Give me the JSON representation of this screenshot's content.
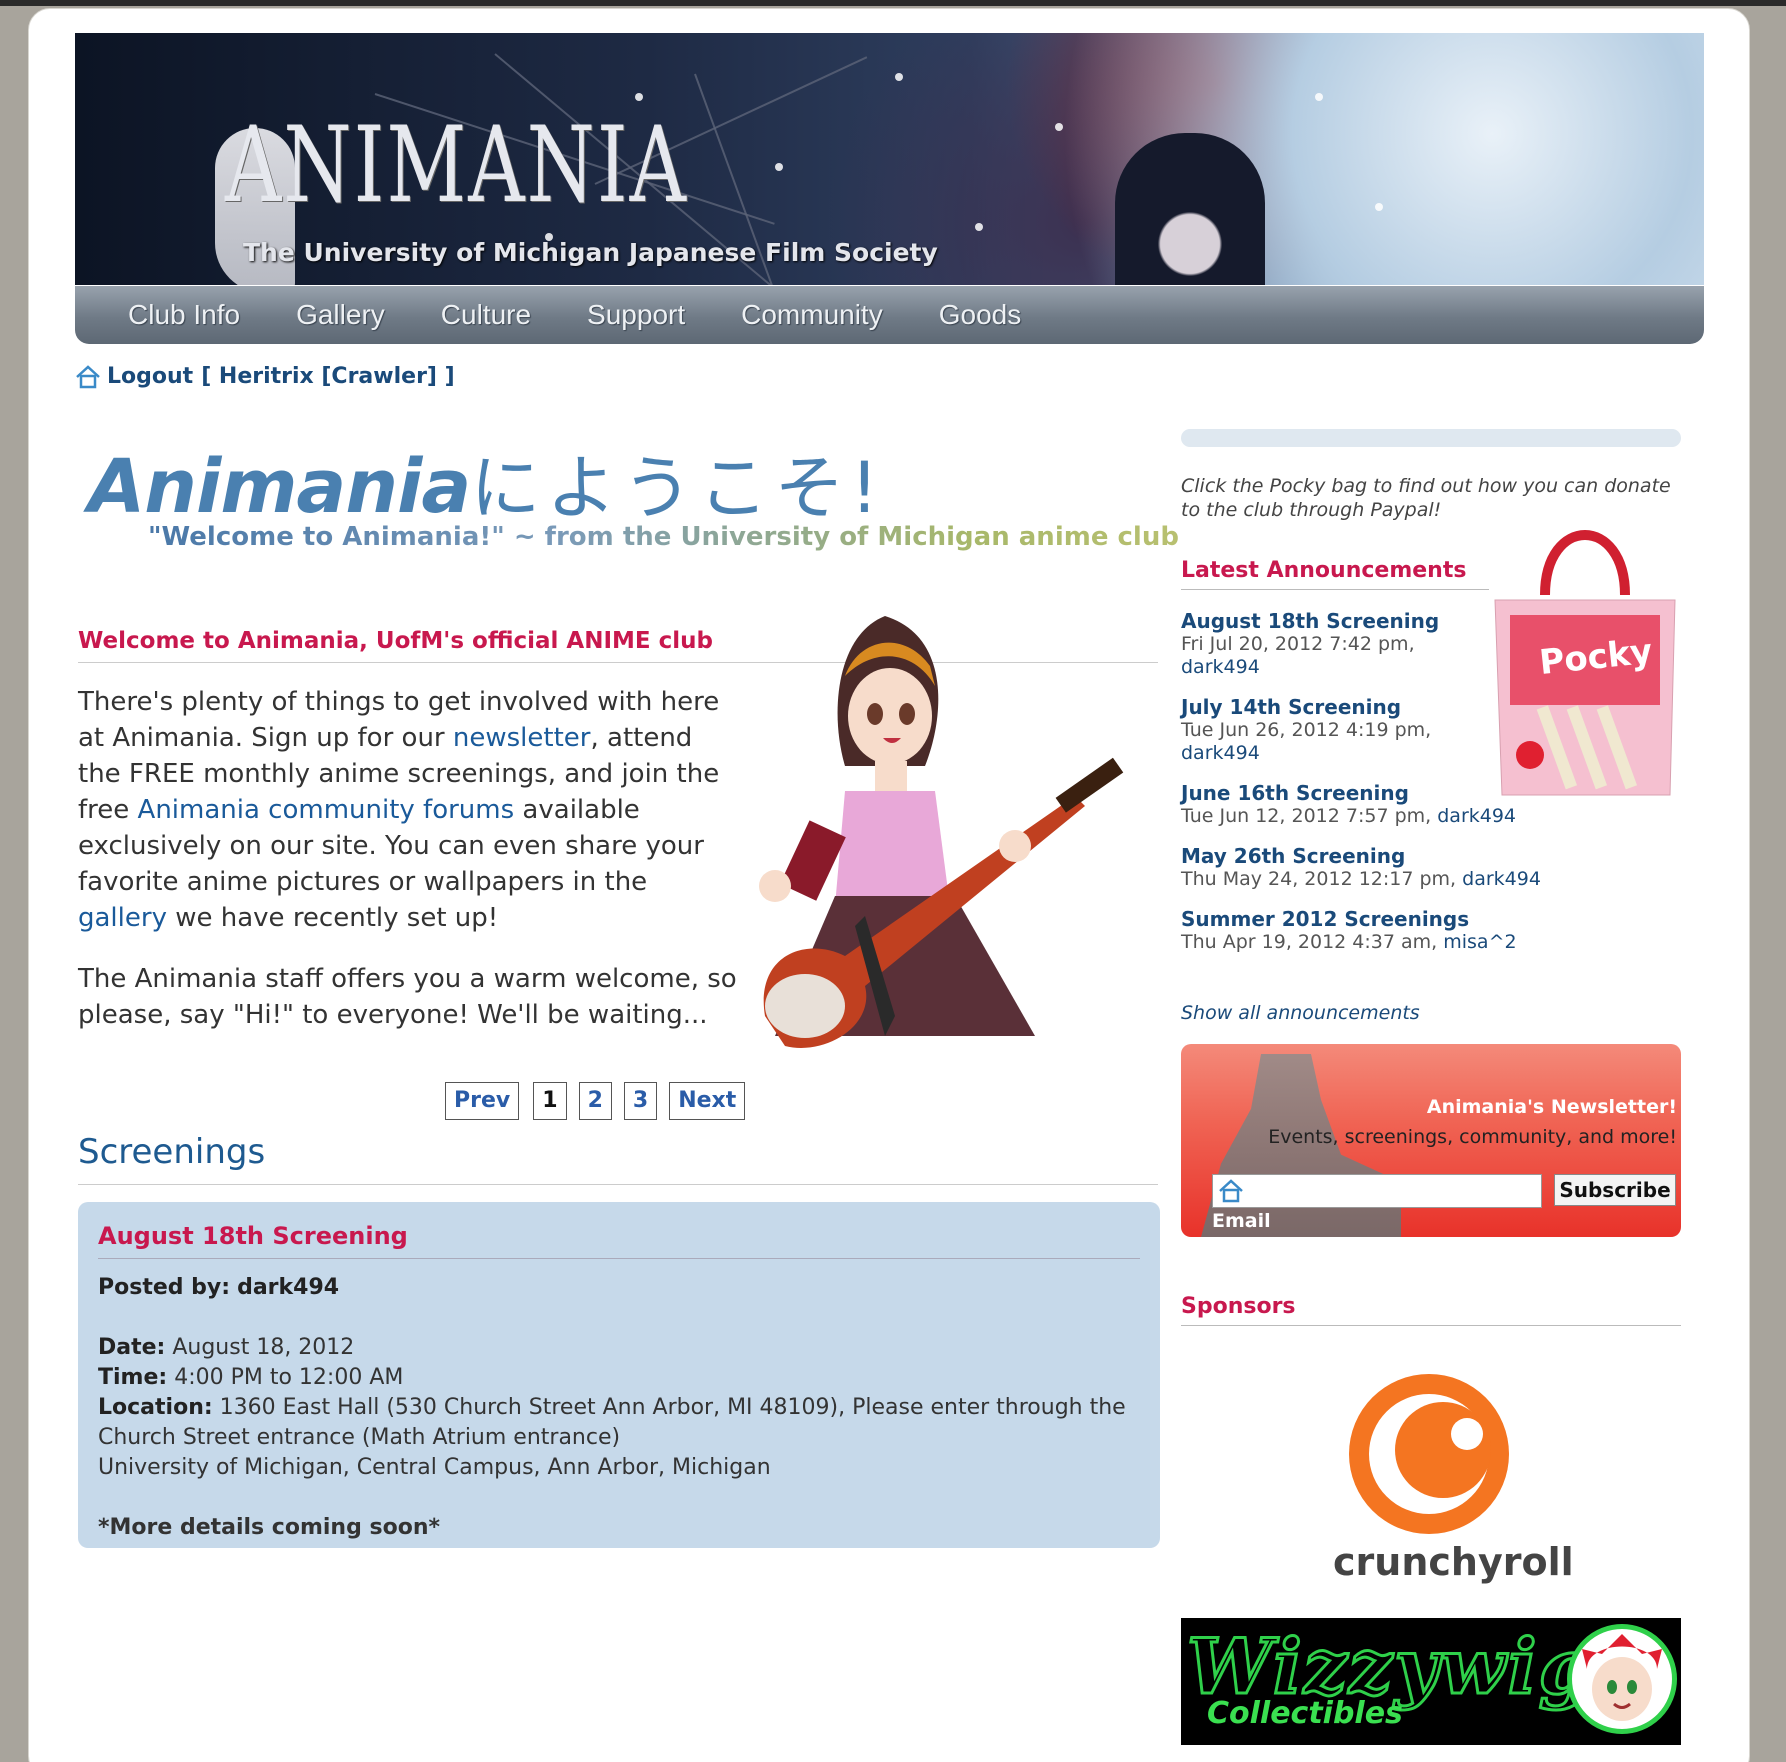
{
  "banner": {
    "logo_text": "ANIMANIA",
    "subtitle": "The University of Michigan Japanese Film Society"
  },
  "nav": {
    "items": [
      "Club Info",
      "Gallery",
      "Culture",
      "Support",
      "Community",
      "Goods"
    ]
  },
  "login": {
    "logout_label": "Logout",
    "user_text": "[ Heritrix [Crawler] ]"
  },
  "welcome": {
    "title_latin": "Animania",
    "title_jp": "にようこそ!",
    "subtitle": "\"Welcome to Animania!\" ~ from the University of Michigan anime club"
  },
  "intro": {
    "heading": "Welcome to Animania, UofM's official ANIME club",
    "p1_a": "There's plenty of things to get involved with here at Animania. Sign up for our ",
    "p1_link1": "newsletter",
    "p1_b": ", attend the FREE monthly anime screenings, and join the free ",
    "p1_link2": "Animania community forums",
    "p1_c": " available exclusively on our site. You can even share your favorite anime pictures or wallpapers in the ",
    "p1_link3": "gallery",
    "p1_d": " we have recently set up!",
    "p2": "The Animania staff offers you a warm welcome, so please, say \"Hi!\" to everyone! We'll be waiting..."
  },
  "pager": {
    "prev": "Prev",
    "pages": [
      "1",
      "2",
      "3"
    ],
    "current": "1",
    "next": "Next"
  },
  "screenings": {
    "heading": "Screenings",
    "post": {
      "title": "August 18th Screening",
      "posted_by_label": "Posted by:",
      "posted_by": "dark494",
      "date_label": "Date:",
      "date": "August 18, 2012",
      "time_label": "Time:",
      "time": "4:00 PM to 12:00 AM",
      "location_label": "Location:",
      "location": "1360 East Hall (530 Church Street Ann Arbor, MI 48109), Please enter through the Church Street entrance (Math Atrium entrance)",
      "location2": "University of Michigan, Central Campus, Ann Arbor, Michigan",
      "note": "*More details coming soon*"
    }
  },
  "sidebar": {
    "donate_note": "Click the Pocky bag to find out how you can donate to the club through Paypal!",
    "announcements_heading": "Latest Announcements",
    "announcements": [
      {
        "title": "August 18th Screening",
        "meta": "Fri Jul 20, 2012 7:42 pm,",
        "user": "dark494"
      },
      {
        "title": "July 14th Screening",
        "meta": "Tue Jun 26, 2012 4:19 pm,",
        "user": "dark494"
      },
      {
        "title": "June 16th Screening",
        "meta": "Tue Jun 12, 2012 7:57 pm,",
        "user": "dark494"
      },
      {
        "title": "May 26th Screening",
        "meta": "Thu May 24, 2012 12:17 pm,",
        "user": "dark494"
      },
      {
        "title": "Summer 2012 Screenings",
        "meta": "Thu Apr 19, 2012 4:37 am,",
        "user": "misa^2"
      }
    ],
    "show_all": "Show all announcements",
    "newsletter": {
      "title": "Animania's Newsletter!",
      "tagline": "Events, screenings, community, and more!",
      "email_label": "Email",
      "email_value": "",
      "subscribe": "Subscribe"
    },
    "sponsors_heading": "Sponsors",
    "sponsor1": "crunchyroll",
    "sponsor2_title": "Wizzywig",
    "sponsor2_sub": "Collectibles"
  },
  "colors": {
    "accent_red": "#c8184e",
    "link_blue": "#1a4a7a",
    "post_bg": "#c6d9ea",
    "crunchyroll_orange": "#f47521",
    "wizzywig_green": "#2fd04a"
  }
}
